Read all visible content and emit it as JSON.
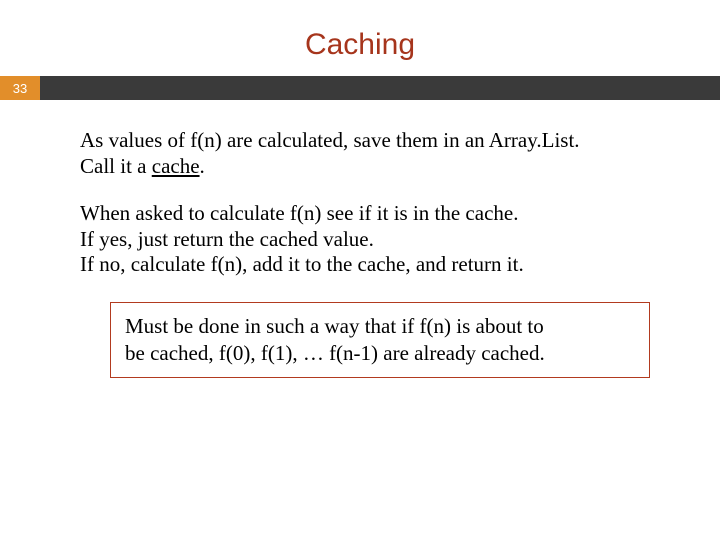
{
  "slide": {
    "title": "Caching",
    "page_number": "33",
    "para1_line1": "As values of f(n) are calculated, save them in an Array.List.",
    "para1_line2a": "Call it a ",
    "para1_line2b": "cache",
    "para1_line2c": ".",
    "para2_line1": "When asked to calculate f(n) see if it is in the cache.",
    "para2_line2": "If yes, just return the cached value.",
    "para2_line3": "If no, calculate f(n), add it to the cache, and return it.",
    "box_line1": "Must be done in such a way that if f(n) is about to",
    "box_line2": "be cached, f(0), f(1), … f(n-1) are already cached."
  }
}
